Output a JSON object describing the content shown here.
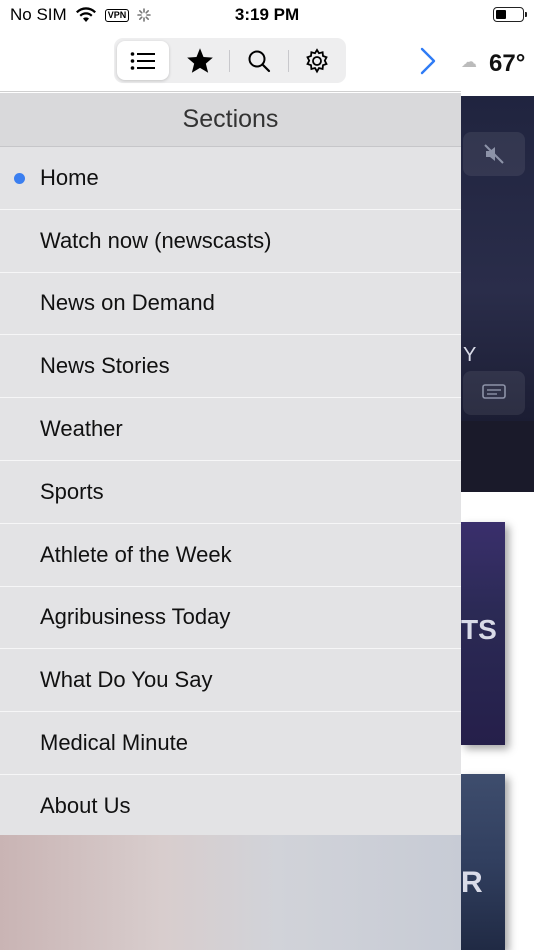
{
  "status": {
    "carrier": "No SIM",
    "vpn": "VPN",
    "time": "3:19 PM"
  },
  "toolbar": {
    "tabs": [
      {
        "icon": "list-icon",
        "active": true
      },
      {
        "icon": "star-icon",
        "active": false
      },
      {
        "icon": "search-icon",
        "active": false
      },
      {
        "icon": "gear-icon",
        "active": false
      }
    ],
    "next_icon": "chevron-right-icon"
  },
  "sections": {
    "title": "Sections",
    "items": [
      {
        "label": "Home",
        "selected": true
      },
      {
        "label": "Watch now (newscasts)",
        "selected": false
      },
      {
        "label": "News on Demand",
        "selected": false
      },
      {
        "label": "News Stories",
        "selected": false
      },
      {
        "label": "Weather",
        "selected": false
      },
      {
        "label": "Sports",
        "selected": false
      },
      {
        "label": "Athlete of the Week",
        "selected": false
      },
      {
        "label": "Agribusiness Today",
        "selected": false
      },
      {
        "label": "What Do You Say",
        "selected": false
      },
      {
        "label": "Medical Minute",
        "selected": false
      },
      {
        "label": "About Us",
        "selected": false
      }
    ]
  },
  "background": {
    "temperature": "67°",
    "fragments": [
      "Y",
      "TS",
      "R"
    ]
  },
  "colors": {
    "accent": "#3b7ff0",
    "menu_bg": "#e3e3e5",
    "header_bg": "#d9d9db"
  }
}
